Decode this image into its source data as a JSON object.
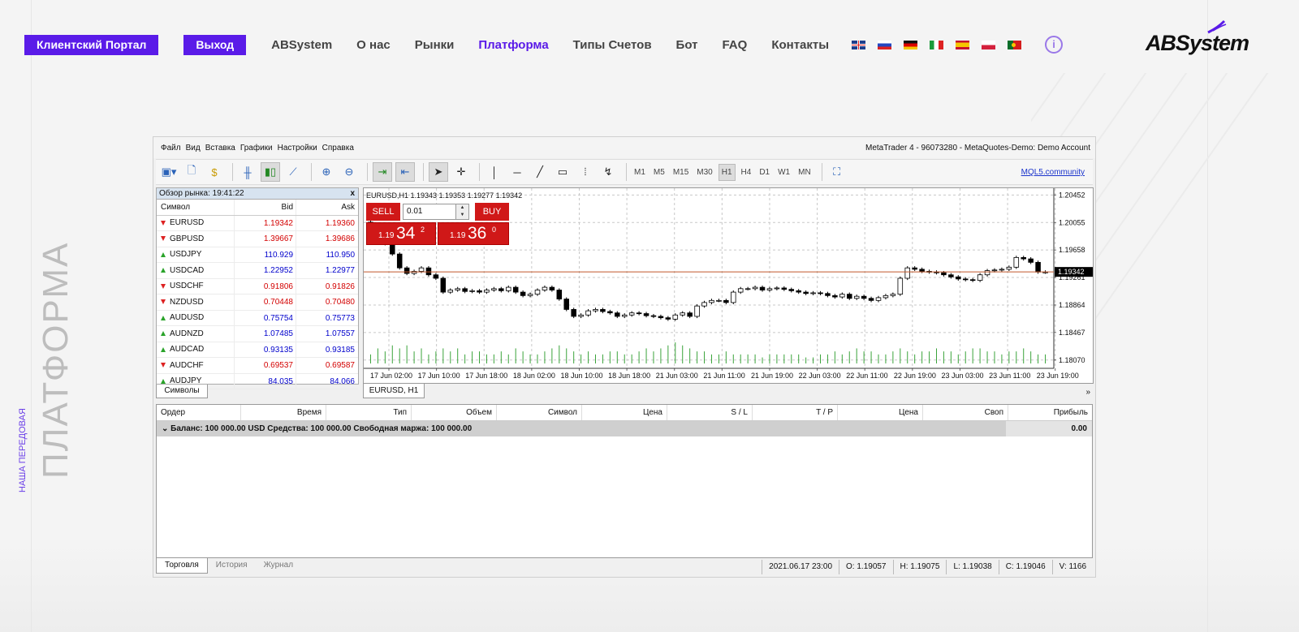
{
  "header": {
    "portal_button": "Клиентский Портал",
    "exit_button": "Выход",
    "nav": [
      "ABSystem",
      "О нас",
      "Рынки",
      "Платформа",
      "Типы Счетов",
      "Бот",
      "FAQ",
      "Контакты"
    ],
    "active_nav": "Платформа",
    "flags": [
      "uk-flag",
      "ru-flag",
      "de-flag",
      "it-flag",
      "es-flag",
      "pl-flag",
      "pt-flag"
    ],
    "info_icon": "i",
    "logo": "ABSystem",
    "accent_color": "#5a1be8"
  },
  "side": {
    "title": "ПЛАТФОРМА",
    "subtitle": "НАША ПЕРЕДОВАЯ"
  },
  "mt4": {
    "menu": [
      "Файл",
      "Вид",
      "Вставка",
      "Графики",
      "Настройки",
      "Справка"
    ],
    "window_title": "MetaTrader 4 - 96073280 - MetaQuotes-Demo: Demo Account",
    "timeframes": [
      "M1",
      "M5",
      "M15",
      "M30",
      "H1",
      "H4",
      "D1",
      "W1",
      "MN"
    ],
    "active_timeframe": "H1",
    "mql5_link": "MQL5.community",
    "market_watch": {
      "title": "Обзор рынка: 19:41:22",
      "close": "x",
      "headers": {
        "symbol": "Символ",
        "bid": "Bid",
        "ask": "Ask"
      },
      "rows": [
        {
          "symbol": "EURUSD",
          "bid": "1.19342",
          "ask": "1.19360",
          "dir": "down"
        },
        {
          "symbol": "GBPUSD",
          "bid": "1.39667",
          "ask": "1.39686",
          "dir": "down"
        },
        {
          "symbol": "USDJPY",
          "bid": "110.929",
          "ask": "110.950",
          "dir": "up"
        },
        {
          "symbol": "USDCAD",
          "bid": "1.22952",
          "ask": "1.22977",
          "dir": "up"
        },
        {
          "symbol": "USDCHF",
          "bid": "0.91806",
          "ask": "0.91826",
          "dir": "down"
        },
        {
          "symbol": "NZDUSD",
          "bid": "0.70448",
          "ask": "0.70480",
          "dir": "down"
        },
        {
          "symbol": "AUDUSD",
          "bid": "0.75754",
          "ask": "0.75773",
          "dir": "up"
        },
        {
          "symbol": "AUDNZD",
          "bid": "1.07485",
          "ask": "1.07557",
          "dir": "up"
        },
        {
          "symbol": "AUDCAD",
          "bid": "0.93135",
          "ask": "0.93185",
          "dir": "up"
        },
        {
          "symbol": "AUDCHF",
          "bid": "0.69537",
          "ask": "0.69587",
          "dir": "down"
        },
        {
          "symbol": "AUDJPY",
          "bid": "84.035",
          "ask": "84.066",
          "dir": "up"
        }
      ],
      "tab": "Символы"
    },
    "chart": {
      "header": "EURUSD,H1  1.19343 1.19353 1.19277 1.19342",
      "tab": "EURUSD, H1",
      "scroll": "»",
      "sell_label": "SELL",
      "buy_label": "BUY",
      "volume": "0.01",
      "sell_price": {
        "small": "1.19",
        "big": "34",
        "sup": "2"
      },
      "buy_price": {
        "small": "1.19",
        "big": "36",
        "sup": "0"
      },
      "current_price": "1.19342"
    },
    "chart_data": {
      "type": "candlestick",
      "symbol": "EURUSD",
      "timeframe": "H1",
      "y_ticks": [
        "1.20452",
        "1.20055",
        "1.19658",
        "1.19261",
        "1.18864",
        "1.18467",
        "1.18070"
      ],
      "y_tick_values": [
        1.20452,
        1.20055,
        1.19658,
        1.19261,
        1.18864,
        1.18467,
        1.1807
      ],
      "ylim": [
        1.1795,
        1.2055
      ],
      "x_ticks": [
        "17 Jun 02:00",
        "17 Jun 10:00",
        "17 Jun 18:00",
        "18 Jun 02:00",
        "18 Jun 10:00",
        "18 Jun 18:00",
        "21 Jun 03:00",
        "21 Jun 11:00",
        "21 Jun 19:00",
        "22 Jun 03:00",
        "22 Jun 11:00",
        "22 Jun 19:00",
        "23 Jun 03:00",
        "23 Jun 11:00",
        "23 Jun 19:00"
      ],
      "current_price": 1.19342,
      "close": [
        1.2,
        1.199,
        1.1975,
        1.196,
        1.194,
        1.1932,
        1.1935,
        1.194,
        1.193,
        1.1925,
        1.1905,
        1.1908,
        1.191,
        1.1906,
        1.1907,
        1.1905,
        1.1908,
        1.191,
        1.1907,
        1.1912,
        1.1905,
        1.19,
        1.1902,
        1.1908,
        1.1912,
        1.1908,
        1.1895,
        1.188,
        1.187,
        1.1872,
        1.1878,
        1.188,
        1.1877,
        1.1875,
        1.187,
        1.1872,
        1.1875,
        1.1874,
        1.1871,
        1.187,
        1.1868,
        1.1866,
        1.1872,
        1.1875,
        1.187,
        1.1885,
        1.189,
        1.1893,
        1.1893,
        1.189,
        1.1905,
        1.191,
        1.191,
        1.1912,
        1.1908,
        1.191,
        1.1911,
        1.1909,
        1.1907,
        1.1905,
        1.1903,
        1.1904,
        1.1903,
        1.19,
        1.1898,
        1.1902,
        1.1896,
        1.1899,
        1.1896,
        1.1893,
        1.1897,
        1.19,
        1.1902,
        1.1925,
        1.194,
        1.1938,
        1.1935,
        1.1934,
        1.1933,
        1.193,
        1.1927,
        1.1924,
        1.1923,
        1.1922,
        1.193,
        1.1936,
        1.1937,
        1.1938,
        1.1941,
        1.1955,
        1.1953,
        1.1948,
        1.1934,
        1.1934
      ],
      "volume": [
        3,
        5,
        4,
        6,
        5,
        6,
        4,
        5,
        3,
        4,
        5,
        4,
        5,
        3,
        4,
        4,
        3,
        3,
        4,
        3,
        5,
        4,
        3,
        3,
        4,
        5,
        6,
        5,
        4,
        3,
        4,
        3,
        3,
        4,
        4,
        3,
        3,
        4,
        5,
        4,
        5,
        6,
        7,
        6,
        5,
        4,
        4,
        3,
        3,
        4,
        3,
        3,
        3,
        3,
        2,
        3,
        3,
        3,
        3,
        3,
        2,
        2,
        3,
        3,
        4,
        3,
        4,
        5,
        4,
        4,
        3,
        3,
        4,
        5,
        4,
        3,
        4,
        4,
        5,
        4,
        4,
        3,
        4,
        5,
        5,
        4,
        4,
        3,
        4,
        4,
        5,
        4,
        3,
        3
      ]
    },
    "terminal": {
      "headers": [
        "Ордер",
        "Время",
        "Тип",
        "Объем",
        "Символ",
        "Цена",
        "S / L",
        "T / P",
        "Цена",
        "Своп",
        "Прибыль"
      ],
      "balance_text": "Баланс: 100 000.00 USD  Средства: 100 000.00  Свободная маржа: 100 000.00",
      "balance_value": "0.00",
      "tabs": [
        "Торговля",
        "История",
        "Журнал"
      ],
      "active_tab": "Торговля"
    },
    "status": [
      "2021.06.17 23:00",
      "O: 1.19057",
      "H: 1.19075",
      "L: 1.19038",
      "C: 1.19046",
      "V: 1166"
    ]
  }
}
